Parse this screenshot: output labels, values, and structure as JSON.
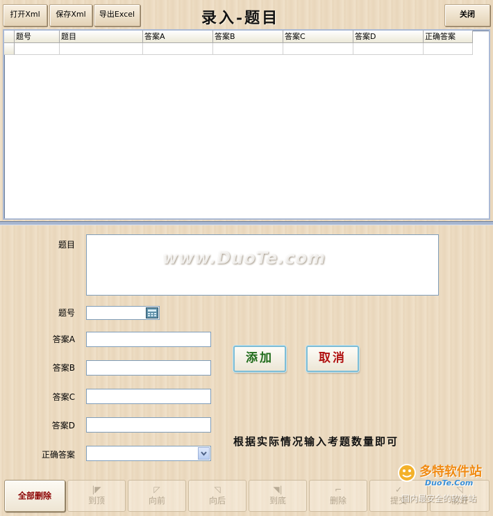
{
  "toolbar": {
    "open_xml": "打开Xml",
    "save_xml": "保存Xml",
    "export_excel": "导出Excel",
    "title": "录入-题目",
    "close": "关闭"
  },
  "grid": {
    "columns": [
      "题号",
      "题目",
      "答案A",
      "答案B",
      "答案C",
      "答案D",
      "正确答案"
    ],
    "rows": [
      [
        "",
        "",
        "",
        "",
        "",
        "",
        ""
      ]
    ]
  },
  "form": {
    "question_label": "题目",
    "question_value": "",
    "number_label": "题号",
    "number_value": "",
    "answer_a_label": "答案A",
    "answer_a_value": "",
    "answer_b_label": "答案B",
    "answer_b_value": "",
    "answer_c_label": "答案C",
    "answer_c_value": "",
    "answer_d_label": "答案D",
    "answer_d_value": "",
    "correct_label": "正确答案",
    "correct_value": ""
  },
  "actions": {
    "add": "添加",
    "cancel": "取消",
    "add_color": "#1f6b1a",
    "cancel_color": "#b01010"
  },
  "hint": "根据实际情况输入考题数量即可",
  "nav": {
    "delete_all": "全部删除",
    "first": "到顶",
    "prev": "向前",
    "next": "向后",
    "last": "到底",
    "delete": "删除",
    "submit": "提交",
    "forward": "前进"
  },
  "watermarks": {
    "site": "www.DuoTe.com",
    "logo_cn": "多特软件站",
    "logo_en": "DuoTe.Com",
    "slogan": "国内最安全的软件站"
  },
  "icons": {
    "number_picker": "calculator-icon",
    "dropdown": "chevron-down-icon"
  }
}
